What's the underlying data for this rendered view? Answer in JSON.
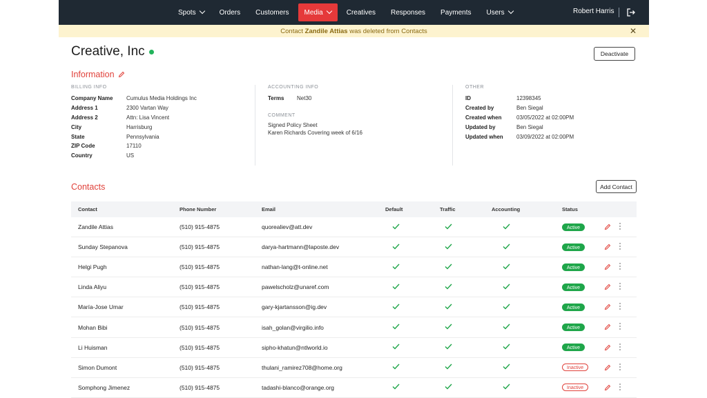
{
  "nav": {
    "items": [
      {
        "label": "Spots",
        "dropdown": true,
        "active": false
      },
      {
        "label": "Orders",
        "dropdown": false,
        "active": false
      },
      {
        "label": "Customers",
        "dropdown": false,
        "active": false
      },
      {
        "label": "Media",
        "dropdown": true,
        "active": true
      },
      {
        "label": "Creatives",
        "dropdown": false,
        "active": false
      },
      {
        "label": "Responses",
        "dropdown": false,
        "active": false
      },
      {
        "label": "Payments",
        "dropdown": false,
        "active": false
      },
      {
        "label": "Users",
        "dropdown": true,
        "active": false
      }
    ],
    "user_name": "Robert Harris",
    "icons": {
      "logout": "logout-icon",
      "dropdown": "chevron-down-icon"
    }
  },
  "toast": {
    "prefix": "Contact",
    "name": "Zandile Attias",
    "suffix": "was deleted from Contacts",
    "close_icon": "close-icon"
  },
  "header": {
    "title": "Creative, Inc",
    "status_color": "#22b35b",
    "deactivate_label": "Deactivate"
  },
  "info": {
    "title": "Information",
    "billing": {
      "heading": "BILLING INFO",
      "rows": [
        {
          "k": "Company Name",
          "v": "Cumulus Media Holdings Inc"
        },
        {
          "k": "Address 1",
          "v": "2300 Vartan Way"
        },
        {
          "k": "Address 2",
          "v": "Attn: Lisa Vincent"
        },
        {
          "k": "City",
          "v": "Harrisburg"
        },
        {
          "k": "State",
          "v": "Pennsylvania"
        },
        {
          "k": "ZIP Code",
          "v": "17110"
        },
        {
          "k": "Country",
          "v": "US"
        }
      ]
    },
    "accounting": {
      "heading": "ACCOUNTING INFO",
      "terms_label": "Terms",
      "terms_value": "Net30",
      "comment_heading": "COMMENT",
      "comment_lines": [
        "Signed Policy Sheet",
        "Karen Richards Covering week of 6/16"
      ]
    },
    "other": {
      "heading": "OTHER",
      "rows": [
        {
          "k": "ID",
          "v": "12398345"
        },
        {
          "k": "Created by",
          "v": "Ben Siegal"
        },
        {
          "k": "Created when",
          "v": "03/05/2022 at 02:00PM"
        },
        {
          "k": "Updated by",
          "v": "Ben Siegal"
        },
        {
          "k": "Updated when",
          "v": "03/09/2022 at 02:00PM"
        }
      ]
    }
  },
  "contacts": {
    "title": "Contacts",
    "add_label": "Add Contact",
    "columns": [
      "Contact",
      "Phone Number",
      "Email",
      "Default",
      "Traffic",
      "Accounting",
      "Status"
    ],
    "rows": [
      {
        "name": "Zandile Attias",
        "phone": "(510) 915-4875",
        "email": "quorealiev@att.dev",
        "status": "Active"
      },
      {
        "name": "Sunday Stepanova",
        "phone": "(510) 915-4875",
        "email": "darya-hartmann@laposte.dev",
        "status": "Active"
      },
      {
        "name": "Helgi Pugh",
        "phone": "(510) 915-4875",
        "email": "nathan-lang@t-online.net",
        "status": "Active"
      },
      {
        "name": "Linda Aliyu",
        "phone": "(510) 915-4875",
        "email": "pawelscholz@unaref.com",
        "status": "Active"
      },
      {
        "name": "María-Jose Umar",
        "phone": "(510) 915-4875",
        "email": "gary-kjartansson@ig.dev",
        "status": "Active"
      },
      {
        "name": "Mohan Bibi",
        "phone": "(510) 915-4875",
        "email": "isah_golan@virgilio.info",
        "status": "Active"
      },
      {
        "name": "Li Huisman",
        "phone": "(510) 915-4875",
        "email": "sipho-khatun@ntlworld.io",
        "status": "Active"
      },
      {
        "name": "Simon Dumont",
        "phone": "(510) 915-4875",
        "email": "thulani_ramirez708@home.org",
        "status": "Inactive"
      },
      {
        "name": "Somphong Jimenez",
        "phone": "(510) 915-4875",
        "email": "tadashi-blanco@orange.org",
        "status": "Inactive"
      }
    ],
    "icons": {
      "check": "check-icon",
      "edit": "pencil-icon",
      "more": "more-vertical-icon"
    }
  },
  "colors": {
    "nav_bg": "#1f2933",
    "accent": "#e5393a",
    "success": "#1fa64a",
    "toast_bg": "#fdf3cf"
  }
}
